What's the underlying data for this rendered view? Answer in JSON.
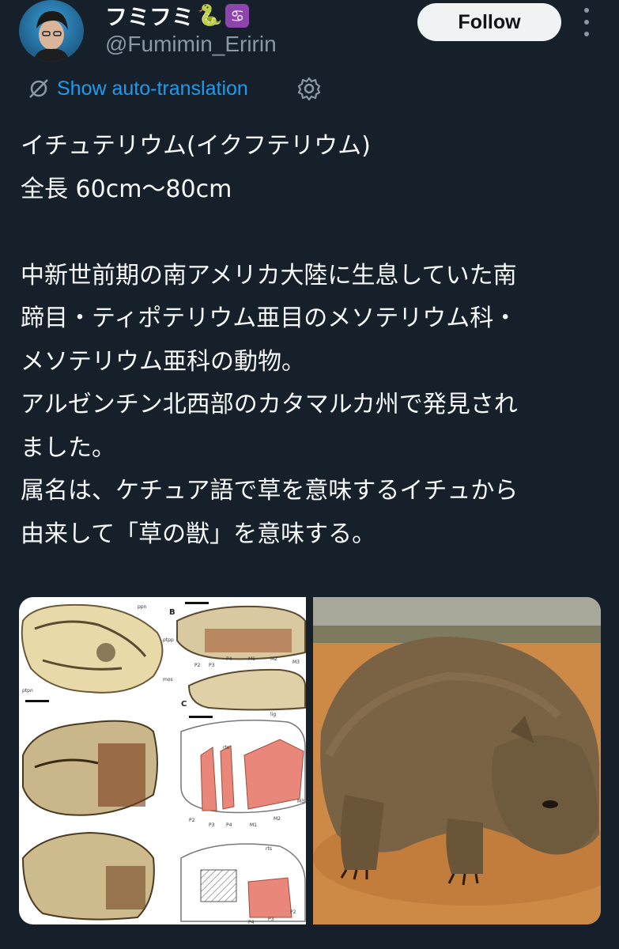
{
  "author": {
    "display_name": "フミフミ",
    "emoji_snake": "🐍",
    "emoji_zodiac": "♋",
    "handle": "@Fumimin_Eririn"
  },
  "follow_label": "Follow",
  "translation": {
    "label": "Show auto-translation"
  },
  "post": {
    "text": "イチュテリウム(イクフテリウム)\n全長 60cm〜80cm\n\n中新世前期の南アメリカ大陸に生息していた南\n蹄目・ティポテリウム亜目のメソテリウム科・\nメソテリウム亜科の動物。\nアルゼンチン北西部のカタマルカ州で発見され\nました。\n属名は、ケチュア語で草を意味するイチュから\n由来して「草の獣」を意味する。"
  },
  "figure": {
    "panel_b": "B",
    "panel_c": "C",
    "labels_top_left": [
      "ppn",
      "ptpp",
      "mos",
      "ptpn"
    ],
    "teeth_upper": [
      "P2",
      "P3",
      "P4",
      "M1",
      "M2",
      "M3"
    ],
    "lig": "lig",
    "rts": "rts",
    "teeth_mid": [
      "P2",
      "P3",
      "P4",
      "M1",
      "M2",
      "M3"
    ],
    "teeth_bottom": [
      "P4",
      "P3",
      "P2"
    ]
  },
  "colors": {
    "background": "#15202b",
    "text": "#f7f9f9",
    "muted": "#8b98a5",
    "link": "#1d9bf0",
    "follow_bg": "#eff3f4",
    "tooth_highlight": "#e8877a"
  },
  "icons": [
    "translate-icon",
    "gear-icon",
    "more-icon"
  ]
}
